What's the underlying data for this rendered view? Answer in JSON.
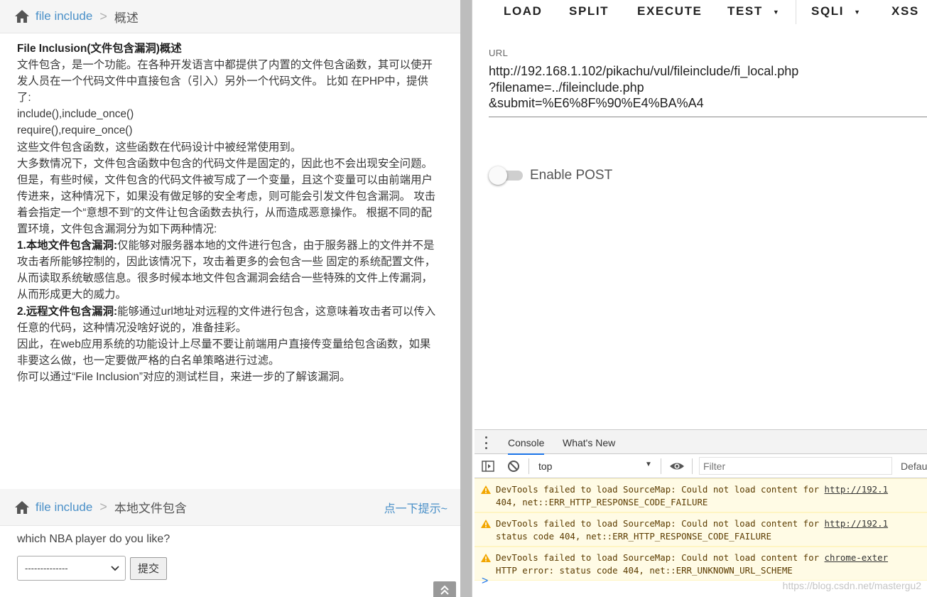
{
  "left": {
    "breadcrumb_top": {
      "link": "file include",
      "separator": ">",
      "current": "概述"
    },
    "article": {
      "title": "File Inclusion(文件包含漏洞)概述",
      "p1": "文件包含，是一个功能。在各种开发语言中都提供了内置的文件包含函数，其可以使开发人员在一个代码文件中直接包含（引入）另外一个代码文件。 比如 在PHP中，提供了:",
      "code1": "include(),include_once()",
      "code2": "require(),require_once()",
      "p2": "这些文件包含函数，这些函数在代码设计中被经常使用到。",
      "p3": "大多数情况下，文件包含函数中包含的代码文件是固定的，因此也不会出现安全问题。 但是，有些时候，文件包含的代码文件被写成了一个变量，且这个变量可以由前端用户传进来，这种情况下，如果没有做足够的安全考虑，则可能会引发文件包含漏洞。 攻击着会指定一个“意想不到”的文件让包含函数去执行，从而造成恶意操作。 根据不同的配置环境，文件包含漏洞分为如下两种情况:",
      "local_title": "1.本地文件包含漏洞:",
      "local_text": "仅能够对服务器本地的文件进行包含，由于服务器上的文件并不是攻击者所能够控制的，因此该情况下，攻击着更多的会包含一些 固定的系统配置文件，从而读取系统敏感信息。很多时候本地文件包含漏洞会结合一些特殊的文件上传漏洞，从而形成更大的威力。",
      "remote_title": "2.远程文件包含漏洞:",
      "remote_text": "能够通过url地址对远程的文件进行包含，这意味着攻击者可以传入任意的代码，这种情况没啥好说的，准备挂彩。",
      "p4": "因此，在web应用系统的功能设计上尽量不要让前端用户直接传变量给包含函数，如果非要这么做，也一定要做严格的白名单策略进行过滤。",
      "p5": "你可以通过“File Inclusion”对应的测试栏目，来进一步的了解该漏洞。"
    },
    "breadcrumb_mid": {
      "link": "file include",
      "separator": ">",
      "current": "本地文件包含",
      "hint": "点一下提示~"
    },
    "form": {
      "question": "which NBA player do you like?",
      "select_value": "--------------",
      "submit_label": "提交"
    }
  },
  "right": {
    "toolbar": {
      "load": "LOAD",
      "split": "SPLIT",
      "execute": "EXECUTE",
      "test": "TEST",
      "sqli": "SQLI",
      "xss": "XSS"
    },
    "url_label": "URL",
    "url_lines": [
      "http://192.168.1.102/pikachu/vul/fileinclude/fi_local.php",
      "?filename=../fileinclude.php",
      "&submit=%E6%8F%90%E4%BA%A4"
    ],
    "enable_post_label": "Enable POST",
    "enable_post_on": false
  },
  "devtools": {
    "tabs": [
      "Console",
      "What's New"
    ],
    "context": "top",
    "filter_placeholder": "Filter",
    "levels_label": "Defau",
    "messages": [
      {
        "line1": "DevTools failed to load SourceMap: Could not load content for ",
        "link": "http://192.1",
        "line2": "404, net::ERR_HTTP_RESPONSE_CODE_FAILURE"
      },
      {
        "line1": "DevTools failed to load SourceMap: Could not load content for ",
        "link": "http://192.1",
        "line2": "status code 404, net::ERR_HTTP_RESPONSE_CODE_FAILURE"
      },
      {
        "line1": "DevTools failed to load SourceMap: Could not load content for ",
        "link": "chrome-exter",
        "line2": "HTTP error: status code 404, net::ERR_UNKNOWN_URL_SCHEME"
      }
    ],
    "prompt": ">",
    "watermark": "https://blog.csdn.net/mastergu2"
  },
  "colors": {
    "link": "#4a90c8",
    "warning_bg": "#fffbe5",
    "accent": "#1a73e8"
  }
}
